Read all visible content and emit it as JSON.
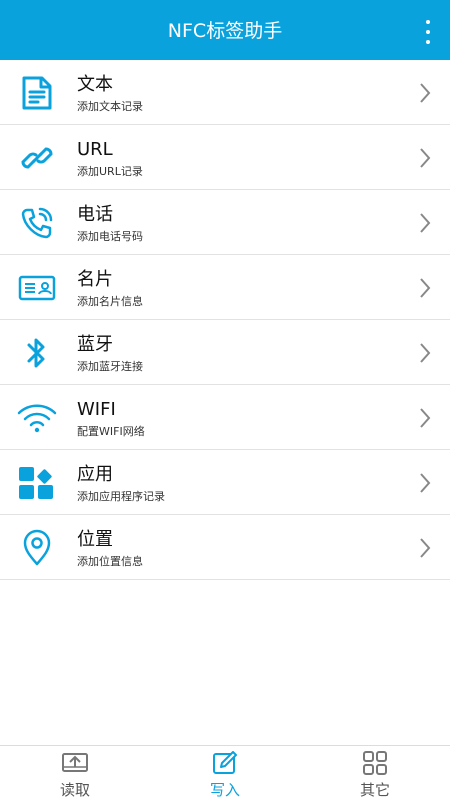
{
  "appbar": {
    "title": "NFC标签助手",
    "more_icon": "more-vert-icon"
  },
  "colors": {
    "primary": "#0aa2dd",
    "text": "#111111",
    "divider": "#e2e2e2"
  },
  "items": [
    {
      "label": "文本",
      "sub": "添加文本记录",
      "icon": "document-icon"
    },
    {
      "label": "URL",
      "sub": "添加URL记录",
      "icon": "link-icon"
    },
    {
      "label": "电话",
      "sub": "添加电话号码",
      "icon": "phone-icon"
    },
    {
      "label": "名片",
      "sub": "添加名片信息",
      "icon": "business-card-icon"
    },
    {
      "label": "蓝牙",
      "sub": "添加蓝牙连接",
      "icon": "bluetooth-icon"
    },
    {
      "label": "WIFI",
      "sub": "配置WIFI网络",
      "icon": "wifi-icon"
    },
    {
      "label": "应用",
      "sub": "添加应用程序记录",
      "icon": "apps-icon"
    },
    {
      "label": "位置",
      "sub": "添加位置信息",
      "icon": "location-pin-icon"
    }
  ],
  "tabs": [
    {
      "label": "读取",
      "icon": "read-tray-icon",
      "active": false
    },
    {
      "label": "写入",
      "icon": "write-edit-icon",
      "active": true
    },
    {
      "label": "其它",
      "icon": "grid-other-icon",
      "active": false
    }
  ]
}
